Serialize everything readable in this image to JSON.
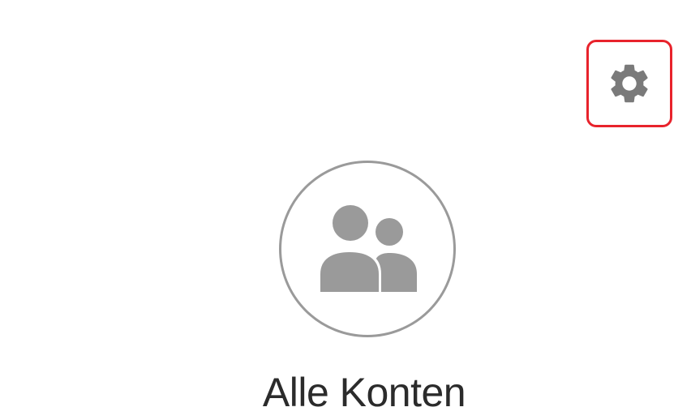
{
  "header": {
    "settings_icon": "gear-icon",
    "settings_highlight_color": "#e8232c"
  },
  "account_selector": {
    "avatar_icon": "group-users-icon",
    "label": "Alle Konten"
  },
  "colors": {
    "icon_gray": "#7a7a7a",
    "avatar_gray": "#9a9a9a",
    "text": "#2b2b2b"
  }
}
